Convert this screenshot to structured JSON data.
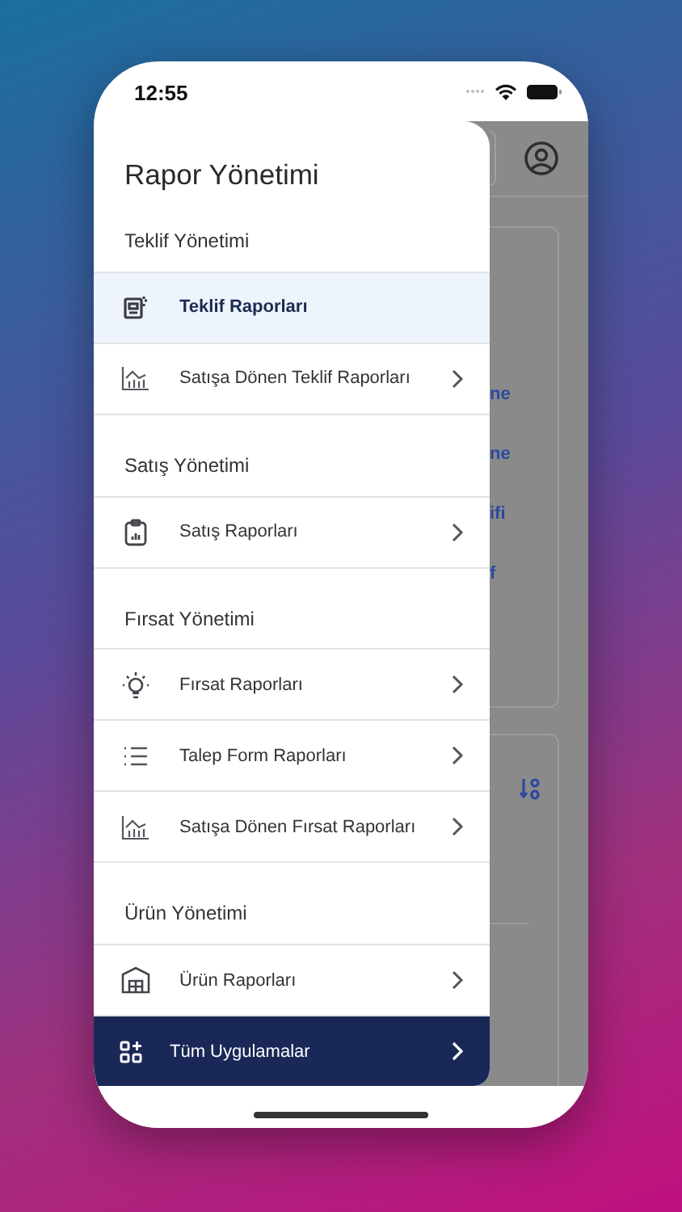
{
  "status_bar": {
    "time": "12:55"
  },
  "drawer": {
    "title": "Rapor Yönetimi",
    "sections": [
      {
        "title": "Teklif Yönetimi",
        "items": [
          {
            "label": "Teklif Raporları",
            "kind": "report",
            "selected": true,
            "chevron": false
          },
          {
            "label": "Satışa Dönen Teklif Raporları",
            "kind": "chart",
            "selected": false,
            "chevron": true
          }
        ]
      },
      {
        "title": "Satış Yönetimi",
        "items": [
          {
            "label": "Satış Raporları",
            "kind": "clipboard",
            "selected": false,
            "chevron": true
          }
        ]
      },
      {
        "title": "Fırsat Yönetimi",
        "items": [
          {
            "label": "Fırsat Raporları",
            "kind": "bulb",
            "selected": false,
            "chevron": true
          },
          {
            "label": "Talep Form Raporları",
            "kind": "list",
            "selected": false,
            "chevron": true
          },
          {
            "label": "Satışa Dönen Fırsat Raporları",
            "kind": "chart",
            "selected": false,
            "chevron": true
          }
        ]
      },
      {
        "title": "Ürün Yönetimi",
        "items": [
          {
            "label": "Ürün Raporları",
            "kind": "building",
            "selected": false,
            "chevron": true
          }
        ]
      }
    ]
  },
  "footer": {
    "label": "Tüm Uygulamalar"
  },
  "background_fragments": [
    "ne",
    "ne",
    "ifi",
    "f"
  ]
}
